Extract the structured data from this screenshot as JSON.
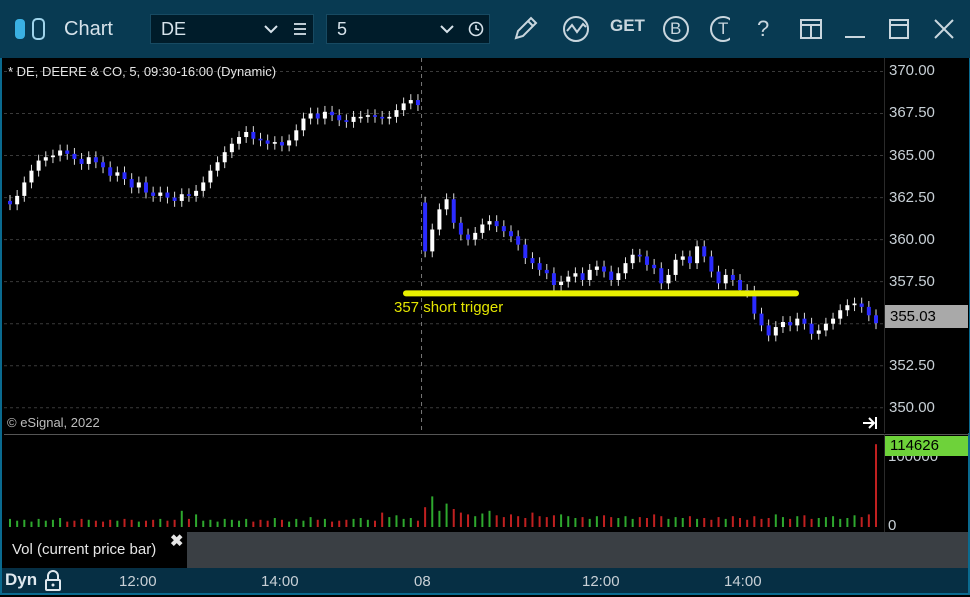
{
  "window": {
    "title": "Chart"
  },
  "toolbar": {
    "symbol_value": "DE",
    "interval_value": "5",
    "get_label": "GET",
    "b_label": "B",
    "t_label": "T",
    "help_label": "?"
  },
  "chart": {
    "symbol_line": "* DE, DEERE & CO, 5, 09:30-16:00 (Dynamic)",
    "copyright": "© eSignal, 2022",
    "annotation": "357 short trigger",
    "current_price": "355.03",
    "price_ticks": [
      "370.00",
      "367.50",
      "365.00",
      "362.50",
      "360.00",
      "357.50",
      "352.50",
      "350.00"
    ],
    "volume_current": "114626",
    "volume_ticks": [
      "100000",
      "0"
    ],
    "volume_legend": "Vol (current price bar)",
    "volume_close": "✖",
    "dyn_label": "Dyn",
    "time_ticks": [
      "12:00",
      "14:00",
      "08",
      "12:00",
      "14:00"
    ],
    "colors": {
      "up": "#ffffff",
      "down": "#2b2bff",
      "annotation_line": "#e8f000",
      "vol_up": "#2ea82e",
      "vol_down": "#c02020"
    }
  },
  "chart_data": {
    "type": "candlestick",
    "title": "* DE, DEERE & CO, 5, 09:30-16:00 (Dynamic)",
    "ylim": [
      348.5,
      370.8
    ],
    "annotation_level": 356.8,
    "close": [
      362.1,
      362.6,
      363.4,
      364.1,
      364.7,
      364.9,
      365.0,
      365.3,
      365.1,
      364.8,
      364.5,
      364.9,
      364.6,
      364.3,
      363.8,
      364.0,
      363.6,
      363.1,
      363.4,
      362.8,
      362.6,
      362.8,
      362.5,
      362.3,
      362.7,
      362.6,
      362.9,
      363.4,
      364.1,
      364.6,
      365.2,
      365.7,
      366.1,
      366.4,
      366.0,
      365.9,
      365.7,
      365.8,
      365.6,
      365.9,
      366.5,
      367.2,
      367.5,
      367.2,
      367.6,
      367.4,
      367.1,
      367.0,
      367.3,
      367.3,
      367.4,
      367.3,
      367.2,
      367.3,
      367.7,
      368.1,
      368.3,
      368.0,
      359.3,
      360.6,
      361.8,
      362.4,
      361.0,
      360.3,
      360.0,
      360.4,
      360.9,
      361.1,
      360.8,
      360.5,
      360.2,
      359.7,
      358.9,
      358.6,
      358.2,
      358.0,
      357.3,
      357.5,
      357.8,
      358.0,
      357.6,
      358.2,
      358.4,
      358.1,
      357.6,
      358.0,
      358.6,
      359.1,
      359.0,
      358.5,
      358.3,
      357.4,
      357.9,
      358.8,
      359.0,
      358.6,
      359.6,
      359.0,
      358.1,
      357.4,
      357.9,
      357.6,
      357.0,
      356.9,
      355.6,
      354.9,
      354.3,
      354.8,
      355.1,
      354.9,
      355.3,
      355.0,
      354.4,
      354.6,
      355.0,
      355.3,
      355.8,
      356.1,
      356.2,
      356.0,
      355.5,
      355.03
    ],
    "volume": [
      9,
      7,
      8,
      6,
      9,
      7,
      8,
      10,
      6,
      7,
      9,
      8,
      7,
      6,
      8,
      7,
      9,
      8,
      6,
      7,
      8,
      9,
      7,
      8,
      18,
      9,
      14,
      7,
      8,
      6,
      9,
      8,
      7,
      9,
      6,
      8,
      7,
      10,
      8,
      6,
      9,
      7,
      11,
      8,
      9,
      6,
      7,
      8,
      9,
      10,
      8,
      7,
      16,
      11,
      13,
      9,
      10,
      7,
      22,
      34,
      18,
      26,
      20,
      16,
      14,
      12,
      15,
      18,
      13,
      11,
      14,
      12,
      10,
      16,
      12,
      11,
      13,
      14,
      12,
      10,
      11,
      9,
      12,
      13,
      11,
      10,
      12,
      9,
      11,
      10,
      14,
      12,
      9,
      11,
      10,
      12,
      9,
      10,
      8,
      11,
      9,
      12,
      10,
      8,
      12,
      9,
      10,
      14,
      11,
      9,
      12,
      13,
      9,
      10,
      11,
      12,
      9,
      10,
      13,
      11,
      14,
      92
    ]
  }
}
